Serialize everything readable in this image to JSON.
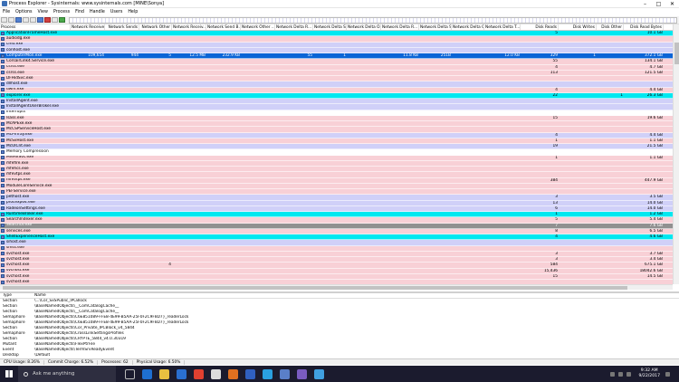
{
  "window": {
    "title": "Process Explorer - Sysinternals: www.sysinternals.com [MINE\\Sonya]"
  },
  "menu": [
    "File",
    "Options",
    "View",
    "Process",
    "Find",
    "Handle",
    "Users",
    "Help"
  ],
  "columns": [
    {
      "label": "Process",
      "w": 78
    },
    {
      "label": "Network Receives",
      "w": 38,
      "right": true
    },
    {
      "label": "Network Sends",
      "w": 38,
      "right": true
    },
    {
      "label": "Network Other",
      "w": 36,
      "right": true
    },
    {
      "label": "Network Receiv...",
      "w": 38,
      "right": true
    },
    {
      "label": "Network Send B...",
      "w": 38,
      "right": true
    },
    {
      "label": "Network Other ...",
      "w": 38,
      "right": true
    },
    {
      "label": "Network Delta R...",
      "w": 42,
      "right": true
    },
    {
      "label": "Network Delta S...",
      "w": 37,
      "right": true
    },
    {
      "label": "Network Delta O...",
      "w": 38,
      "right": true
    },
    {
      "label": "Network Delta R...",
      "w": 42,
      "right": true
    },
    {
      "label": "Network Delta S...",
      "w": 36,
      "right": true
    },
    {
      "label": "Network Delta O...",
      "w": 36,
      "right": true
    },
    {
      "label": "Network Delta T...",
      "w": 40,
      "right": true
    },
    {
      "label": "Disk Reads",
      "w": 42,
      "right": true
    },
    {
      "label": "Disk Writes",
      "w": 42,
      "right": true
    },
    {
      "label": "Disk Other",
      "w": 30,
      "right": true
    },
    {
      "label": "Disk Read Bytes",
      "w": 44,
      "right": true
    }
  ],
  "rows": [
    {
      "name": "ApplicationFrameHost.exe",
      "style": "cyan",
      "vals": {
        "14": "5",
        "17": "10.1 GB"
      }
    },
    {
      "name": "audiodg.exe",
      "style": "pink",
      "vals": {}
    },
    {
      "name": "cmd.exe",
      "style": "lav",
      "vals": {}
    },
    {
      "name": "conhost.exe",
      "style": "lav",
      "vals": {}
    },
    {
      "name": "ComputerMon.exe",
      "style": "sel",
      "vals": {
        "1": "109,654",
        "2": "944",
        "3": "5",
        "4": "12.5 MB",
        "5": "232.9 KB",
        "7": "55",
        "8": "1",
        "10": "11.8 KB",
        "11": "251B",
        "13": "12.0 KB",
        "14": "329",
        "15": "1",
        "17": "372.1 GB"
      }
    },
    {
      "name": "CorsairLink4.Service.exe",
      "style": "pink",
      "vals": {
        "14": "55",
        "17": "134.1 GB"
      }
    },
    {
      "name": "csrss.exe",
      "style": "pink",
      "vals": {
        "14": "4",
        "17": "4.7 GB"
      }
    },
    {
      "name": "csrss.exe",
      "style": "pink",
      "vals": {
        "14": "113",
        "17": "121.5 GB"
      }
    },
    {
      "name": "DFHidSvc.exe",
      "style": "pink",
      "vals": {}
    },
    {
      "name": "dllhost.exe",
      "style": "lav",
      "vals": {}
    },
    {
      "name": "dwm.exe",
      "style": "pink",
      "vals": {
        "14": "4",
        "17": "4.4 GB"
      }
    },
    {
      "name": "explorer.exe",
      "style": "cyan",
      "vals": {
        "14": "22",
        "16": "1",
        "17": "26.3 GB"
      }
    },
    {
      "name": "InstallAgent.exe",
      "style": "lav",
      "vals": {}
    },
    {
      "name": "InstallAgentUserBroker.exe",
      "style": "lav",
      "vals": {}
    },
    {
      "name": "Interrupts",
      "style": "white",
      "vals": {}
    },
    {
      "name": "lsass.exe",
      "style": "pink",
      "vals": {
        "14": "15",
        "17": "19.6 GB"
      }
    },
    {
      "name": "McAPExe.exe",
      "style": "pink",
      "vals": {}
    },
    {
      "name": "McCSPServiceHost.exe",
      "style": "pink",
      "vals": {}
    },
    {
      "name": "McPvTray.exe",
      "style": "lav",
      "vals": {
        "14": "4",
        "17": "4.4 GB"
      }
    },
    {
      "name": "McSvHost.exe",
      "style": "pink",
      "vals": {
        "14": "1",
        "17": "1.1 GB"
      }
    },
    {
      "name": "McUICnt.exe",
      "style": "lav",
      "vals": {
        "14": "19",
        "17": "21.5 GB"
      }
    },
    {
      "name": "Memory Compression",
      "style": "white",
      "vals": {}
    },
    {
      "name": "MfeAVSvc.exe",
      "style": "pink",
      "vals": {
        "14": "1",
        "17": "1.1 GB"
      }
    },
    {
      "name": "mfefire.exe",
      "style": "pink",
      "vals": {}
    },
    {
      "name": "mfehcs.exe",
      "style": "pink",
      "vals": {}
    },
    {
      "name": "mfevtps.exe",
      "style": "pink",
      "vals": {}
    },
    {
      "name": "mfevtps.exe",
      "style": "pink",
      "vals": {
        "14": "384",
        "17": "447.9 GB"
      }
    },
    {
      "name": "ModuleCoreService.exe",
      "style": "pink",
      "vals": {}
    },
    {
      "name": "PEFService.exe",
      "style": "pink",
      "vals": {}
    },
    {
      "name": "pethost.exe",
      "style": "lav",
      "vals": {
        "14": "3",
        "17": "3.5 GB"
      }
    },
    {
      "name": "procexp64.exe",
      "style": "lav",
      "vals": {
        "14": "13",
        "17": "14.0 GB"
      }
    },
    {
      "name": "RadeonSettings.exe",
      "style": "lav",
      "vals": {
        "14": "6",
        "17": "14.0 GB"
      }
    },
    {
      "name": "RuntimeBroker.exe",
      "style": "cyan",
      "vals": {
        "14": "1",
        "17": "1.2 GB"
      }
    },
    {
      "name": "SearchIndexer.exe",
      "style": "pink",
      "vals": {
        "14": "5",
        "17": "5.4 GB"
      }
    },
    {
      "name": "SearchUI.exe",
      "style": "gray",
      "vals": {
        "14": "7",
        "17": "7.6 GB"
      }
    },
    {
      "name": "services.exe",
      "style": "pink",
      "vals": {
        "14": "8",
        "17": "6.5 GB"
      }
    },
    {
      "name": "ShellExperienceHost.exe",
      "style": "cyan",
      "vals": {
        "14": "4",
        "17": "4.6 GB"
      }
    },
    {
      "name": "sihost.exe",
      "style": "lav",
      "vals": {}
    },
    {
      "name": "smss.exe",
      "style": "pink",
      "vals": {}
    },
    {
      "name": "svchost.exe",
      "style": "pink",
      "vals": {
        "14": "3",
        "17": "3.7 GB"
      }
    },
    {
      "name": "svchost.exe",
      "style": "pink",
      "vals": {
        "14": "3",
        "17": "3.4 GB"
      }
    },
    {
      "name": "svchost.exe",
      "style": "pink",
      "vals": {
        "3": "4",
        "14": "584",
        "17": "675.1 GB"
      }
    },
    {
      "name": "svchost.exe",
      "style": "pink",
      "vals": {
        "14": "15,436",
        "17": "18042.6 GB"
      }
    },
    {
      "name": "svchost.exe",
      "style": "pink",
      "vals": {
        "14": "15",
        "17": "14.5 GB"
      }
    },
    {
      "name": "svchost.exe",
      "style": "pink",
      "vals": {}
    }
  ],
  "lower": {
    "headers": [
      "Type",
      "Name"
    ],
    "rows": [
      [
        "Section",
        "\\...\\Cor_SxSPublic_IPCBlock"
      ],
      [
        "Section",
        "\\BaseNamedObjects\\__ComCatalogCache__"
      ],
      [
        "Section",
        "\\BaseNamedObjects\\__ComCatalogCache__"
      ],
      [
        "Semaphore",
        "\\BaseNamedObjects\\C6E851089-FFE8-4E99-B5AA-25F0F2C9F8D7}_readerLock"
      ],
      [
        "Semaphore",
        "\\BaseNamedObjects\\C6E851089-FFE8-4E99-B5AA-25F0F2C9F8D7}_readerLock"
      ],
      [
        "Section",
        "\\BaseNamedObjects\\Cor_Private_IPCBlock_v4_5844"
      ],
      [
        "Semaphore",
        "\\BaseNamedObjects\\CrossLinkSettingsProfiles"
      ],
      [
        "Section",
        "\\BaseNamedObjects\\CRYPTE_5844_v4.0.30319"
      ],
      [
        "Mutant",
        "\\BaseNamedObjects\\FlexPtrFile"
      ],
      [
        "Event",
        "\\BaseNamedObjects\\TermSrvReadyEvent"
      ],
      [
        "Desktop",
        "\\Default"
      ]
    ]
  },
  "status": {
    "cpu": "CPU Usage: 8.26%",
    "commit": "Commit Charge: 6.52%",
    "processes": "Processes: 62",
    "physical": "Physical Usage: 6.50%"
  },
  "taskbar": {
    "search_placeholder": "Ask me anything",
    "time": "9:32 AM",
    "date": "9/22/2017"
  }
}
